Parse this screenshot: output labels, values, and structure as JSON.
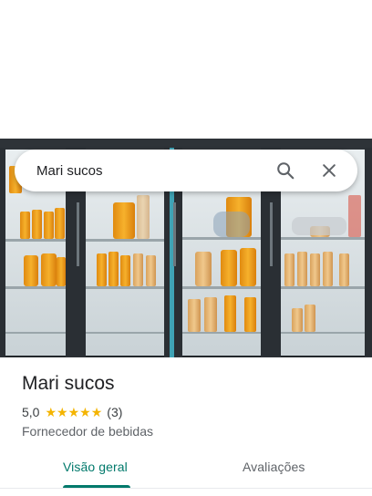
{
  "search": {
    "query": "Mari sucos"
  },
  "icons": {
    "search": "search-icon",
    "close": "close-icon",
    "star": "star-icon"
  },
  "place": {
    "name": "Mari sucos",
    "rating": "5,0",
    "stars": 5,
    "reviews_count": "(3)",
    "category": "Fornecedor de bebidas"
  },
  "tabs": [
    {
      "label": "Visão geral",
      "selected": true
    },
    {
      "label": "Avaliações",
      "selected": false
    }
  ],
  "colors": {
    "accent": "#00796b",
    "star": "#f4b400",
    "text_primary": "#202124",
    "text_secondary": "#5f6368"
  }
}
